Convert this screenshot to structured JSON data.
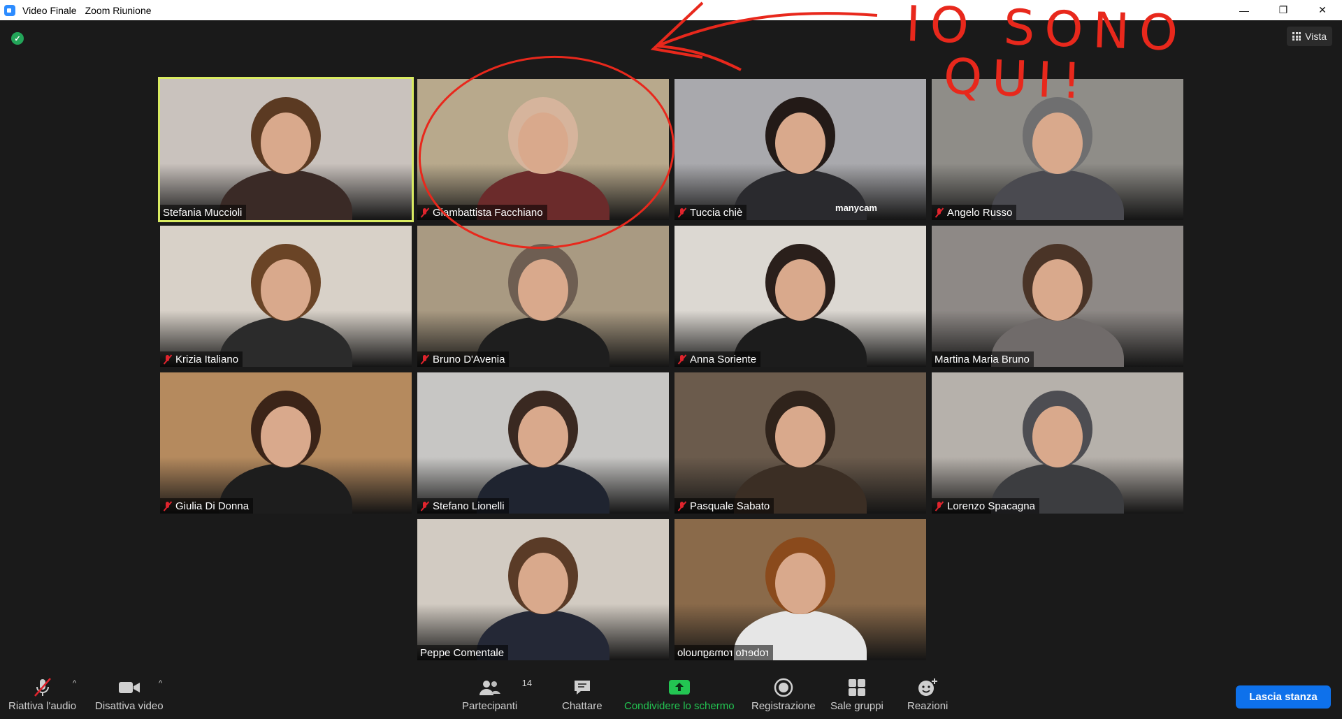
{
  "window": {
    "title": "Video Finale",
    "app_name": "Zoom Riunione",
    "minimize": "—",
    "restore": "❐",
    "close": "✕"
  },
  "view_button": {
    "label": "Vista"
  },
  "annotation": {
    "line1": "IO SONO",
    "line2": "QUI!",
    "color": "#e8281c"
  },
  "participants": [
    {
      "name": "Stefania Muccioli",
      "muted": false,
      "active": true,
      "bg": "#c9c2bd",
      "fg": "#3a2a26",
      "hair": "#5b3a22"
    },
    {
      "name": "Giambattista Facchiano",
      "muted": true,
      "active": false,
      "bg": "#b8a98c",
      "fg": "#6b2b2b",
      "hair": "#d6b49c"
    },
    {
      "name": "Tuccia chiè",
      "muted": true,
      "active": false,
      "bg": "#a9a9ad",
      "fg": "#2a2a2e",
      "hair": "#231a17",
      "watermark": "manycam"
    },
    {
      "name": "Angelo Russo",
      "muted": true,
      "active": false,
      "bg": "#8f8d88",
      "fg": "#4a4a50",
      "hair": "#6f6f70"
    },
    {
      "name": "Krizia Italiano",
      "muted": true,
      "active": false,
      "bg": "#d8d1c8",
      "fg": "#2b2b2b",
      "hair": "#6a4426"
    },
    {
      "name": "Bruno D'Avenia",
      "muted": true,
      "active": false,
      "bg": "#a99a82",
      "fg": "#1e1e1e",
      "hair": "#6e5e52"
    },
    {
      "name": "Anna Soriente",
      "muted": true,
      "active": false,
      "bg": "#dcd8d2",
      "fg": "#1c1c1c",
      "hair": "#2a1f1b"
    },
    {
      "name": "Martina Maria Bruno",
      "muted": false,
      "active": false,
      "bg": "#8e8986",
      "fg": "#706b6a",
      "hair": "#4a3427"
    },
    {
      "name": "Giulia Di Donna",
      "muted": true,
      "active": false,
      "bg": "#b58a5e",
      "fg": "#1d1d1d",
      "hair": "#3b2418"
    },
    {
      "name": "Stefano Lionelli",
      "muted": true,
      "active": false,
      "bg": "#c7c6c4",
      "fg": "#1f2430",
      "hair": "#3a2921"
    },
    {
      "name": "Pasquale Sabato",
      "muted": true,
      "active": false,
      "bg": "#6b5b4c",
      "fg": "#3b2e24",
      "hair": "#2f231b"
    },
    {
      "name": "Lorenzo Spacagna",
      "muted": true,
      "active": false,
      "bg": "#b6b1ab",
      "fg": "#3c3d40",
      "hair": "#4d4d52"
    },
    {
      "name": "Peppe Comentale",
      "muted": false,
      "active": false,
      "bg": "#d2cbc2",
      "fg": "#242836",
      "hair": "#5a3b27"
    },
    {
      "name": "roberto romagnuolo",
      "muted": false,
      "active": false,
      "bg": "#8a6a4a",
      "fg": "#e6e6e6",
      "hair": "#8a4a1c",
      "mirrored": true
    }
  ],
  "toolbar": {
    "audio_label": "Riattiva l'audio",
    "video_label": "Disattiva video",
    "participants_label": "Partecipanti",
    "participants_count": "14",
    "chat_label": "Chattare",
    "share_label": "Condividere lo schermo",
    "record_label": "Registrazione",
    "rooms_label": "Sale gruppi",
    "reactions_label": "Reazioni",
    "leave_label": "Lascia stanza",
    "share_color": "#23c552",
    "leave_color": "#0e71eb"
  }
}
